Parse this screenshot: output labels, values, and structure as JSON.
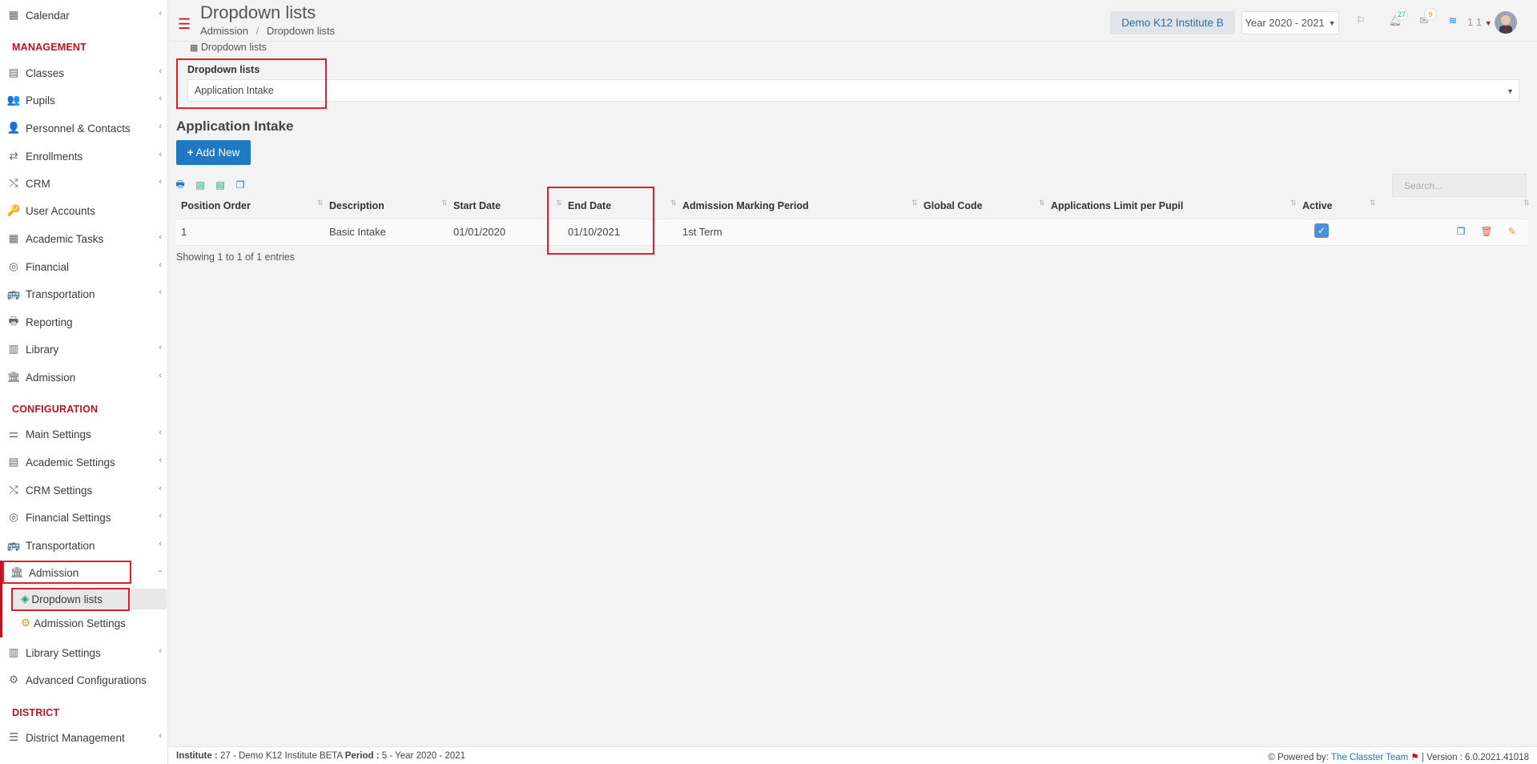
{
  "sidebar": {
    "items_top": [
      {
        "label": "Calendar",
        "icon": "calendar-icon",
        "chevron": true
      },
      {
        "label": "Classes",
        "icon": "classes-icon",
        "chevron": true
      },
      {
        "label": "Pupils",
        "icon": "pupils-icon",
        "chevron": true
      },
      {
        "label": "Personnel & Contacts",
        "icon": "personnel-icon",
        "chevron": true
      },
      {
        "label": "Enrollments",
        "icon": "enrollments-icon",
        "chevron": true
      },
      {
        "label": "CRM",
        "icon": "crm-icon",
        "chevron": true
      },
      {
        "label": "User Accounts",
        "icon": "user-accounts-icon",
        "chevron": false
      },
      {
        "label": "Academic Tasks",
        "icon": "academic-tasks-icon",
        "chevron": true
      },
      {
        "label": "Financial",
        "icon": "financial-icon",
        "chevron": true
      },
      {
        "label": "Transportation",
        "icon": "transportation-icon",
        "chevron": true
      },
      {
        "label": "Reporting",
        "icon": "reporting-icon",
        "chevron": false
      },
      {
        "label": "Library",
        "icon": "library-icon",
        "chevron": true
      },
      {
        "label": "Admission",
        "icon": "admission-icon",
        "chevron": true
      }
    ],
    "section_management": "MANAGEMENT",
    "section_configuration": "CONFIGURATION",
    "section_district": "DISTRICT",
    "config_items": [
      {
        "label": "Main Settings",
        "icon": "main-settings-icon"
      },
      {
        "label": "Academic Settings",
        "icon": "academic-settings-icon"
      },
      {
        "label": "CRM Settings",
        "icon": "crm-settings-icon"
      },
      {
        "label": "Financial Settings",
        "icon": "financial-settings-icon"
      },
      {
        "label": "Transportation",
        "icon": "transportation-icon"
      }
    ],
    "admission_open": "Admission",
    "sub_dropdown_lists": "Dropdown lists",
    "sub_admission_settings": "Admission Settings",
    "library_settings": "Library Settings",
    "advanced_configurations": "Advanced Configurations",
    "district_management": "District Management",
    "accent_color": "#c0111f"
  },
  "header": {
    "title": "Dropdown lists",
    "breadcrumb_1": "Admission",
    "breadcrumb_sep": "/",
    "breadcrumb_2": "Dropdown lists",
    "institute": "Demo K12 Institute B",
    "year": "Year 2020 - 2021",
    "notifications_count": "27",
    "messages_count": "9",
    "user_num": "1 1"
  },
  "main": {
    "panel_tab": "Dropdown lists",
    "dropdown_label": "Dropdown lists",
    "dropdown_value": "Application Intake",
    "section_title": "Application Intake",
    "add_new": "Add New",
    "search_placeholder": "Search...",
    "table": {
      "headers": [
        "Position Order",
        "Description",
        "Start Date",
        "End Date",
        "Admission Marking Period",
        "Global Code",
        "Applications Limit per Pupil",
        "Active"
      ],
      "row": {
        "position_order": "1",
        "description": "Basic Intake",
        "start_date": "01/01/2020",
        "end_date": "01/10/2021",
        "marking_period": "1st Term",
        "global_code": "",
        "limit": "",
        "active": true
      }
    },
    "showing": "Showing 1 to 1 of 1 entries"
  },
  "footer": {
    "institute_label": "Institute :",
    "institute_value": "27 - Demo K12 Institute BETA",
    "period_label": "Period :",
    "period_value": "5 - Year 2020 - 2021",
    "powered_by": "Powered by:",
    "team": "The Classter Team",
    "version": "| Version : 6.0.2021.41018"
  }
}
